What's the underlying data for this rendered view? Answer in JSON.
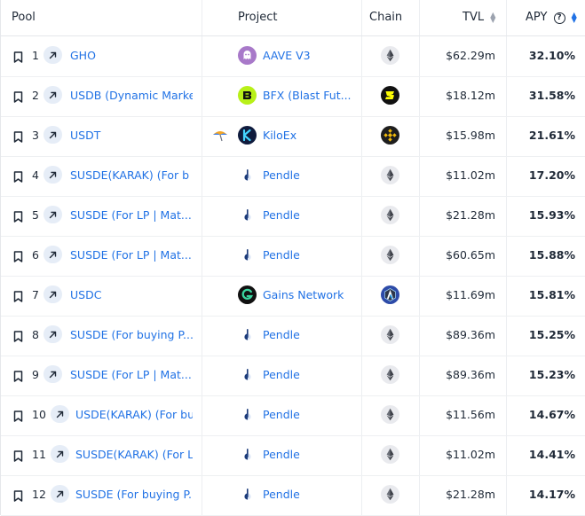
{
  "header": {
    "pool": "Pool",
    "project": "Project",
    "chain": "Chain",
    "tvl": "TVL",
    "apy": "APY",
    "help": "?"
  },
  "colors": {
    "link": "#2172e5",
    "text": "#1f2937",
    "badge_bg": "#e6edf7"
  },
  "rows": [
    {
      "rank": "1",
      "pool": "GHO",
      "project": "AAVE V3",
      "project_icon": "aave-icon",
      "chain_icon": "ethereum-icon",
      "tvl": "$62.29m",
      "apy": "32.10%"
    },
    {
      "rank": "2",
      "pool": "USDB (Dynamic Marke",
      "project": "BFX (Blast Fut...",
      "project_icon": "bfx-icon",
      "chain_icon": "blast-icon",
      "tvl": "$18.12m",
      "apy": "31.58%"
    },
    {
      "rank": "3",
      "pool": "USDT",
      "project": "KiloEx",
      "project_icon": "kiloex-icon",
      "chain_icon": "bsc-icon",
      "tvl": "$15.98m",
      "apy": "21.61%"
    },
    {
      "rank": "4",
      "pool": "SUSDE(KARAK) (For b",
      "project": "Pendle",
      "project_icon": "pendle-icon",
      "chain_icon": "ethereum-icon",
      "tvl": "$11.02m",
      "apy": "17.20%"
    },
    {
      "rank": "5",
      "pool": "SUSDE (For LP | Mat...",
      "project": "Pendle",
      "project_icon": "pendle-icon",
      "chain_icon": "ethereum-icon",
      "tvl": "$21.28m",
      "apy": "15.93%"
    },
    {
      "rank": "6",
      "pool": "SUSDE (For LP | Mat...",
      "project": "Pendle",
      "project_icon": "pendle-icon",
      "chain_icon": "ethereum-icon",
      "tvl": "$60.65m",
      "apy": "15.88%"
    },
    {
      "rank": "7",
      "pool": "USDC",
      "project": "Gains Network",
      "project_icon": "gains-icon",
      "chain_icon": "arbitrum-icon",
      "tvl": "$11.69m",
      "apy": "15.81%"
    },
    {
      "rank": "8",
      "pool": "SUSDE (For buying P...",
      "project": "Pendle",
      "project_icon": "pendle-icon",
      "chain_icon": "ethereum-icon",
      "tvl": "$89.36m",
      "apy": "15.25%"
    },
    {
      "rank": "9",
      "pool": "SUSDE (For LP | Mat...",
      "project": "Pendle",
      "project_icon": "pendle-icon",
      "chain_icon": "ethereum-icon",
      "tvl": "$89.36m",
      "apy": "15.23%"
    },
    {
      "rank": "10",
      "pool": "USDE(KARAK) (For bu",
      "project": "Pendle",
      "project_icon": "pendle-icon",
      "chain_icon": "ethereum-icon",
      "tvl": "$11.56m",
      "apy": "14.67%"
    },
    {
      "rank": "11",
      "pool": "SUSDE(KARAK) (For L",
      "project": "Pendle",
      "project_icon": "pendle-icon",
      "chain_icon": "ethereum-icon",
      "tvl": "$11.02m",
      "apy": "14.41%"
    },
    {
      "rank": "12",
      "pool": "SUSDE (For buying P...",
      "project": "Pendle",
      "project_icon": "pendle-icon",
      "chain_icon": "ethereum-icon",
      "tvl": "$21.28m",
      "apy": "14.17%"
    }
  ]
}
